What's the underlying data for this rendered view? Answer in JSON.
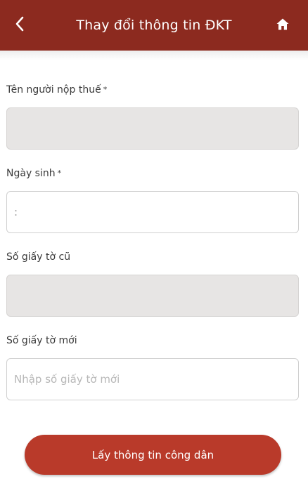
{
  "header": {
    "title": "Thay đổi thông tin ĐKT",
    "back_icon": "chevron-left-icon",
    "home_icon": "home-icon"
  },
  "form": {
    "taxpayer_name": {
      "label": "Tên người nộp thuế",
      "required_mark": "*",
      "value": ""
    },
    "birth_date": {
      "label": "Ngày sinh",
      "required_mark": "*",
      "value": ":"
    },
    "old_id_number": {
      "label": "Số giấy tờ cũ",
      "value": ""
    },
    "new_id_number": {
      "label": "Số giấy tờ mới",
      "placeholder": "Nhập số giấy tờ mới",
      "value": ""
    }
  },
  "actions": {
    "submit_label": "Lấy thông tin công dân"
  },
  "colors": {
    "header_bg": "#8c2a1f",
    "button_bg": "#b93a2a",
    "disabled_field_bg": "#e7e5e4"
  }
}
